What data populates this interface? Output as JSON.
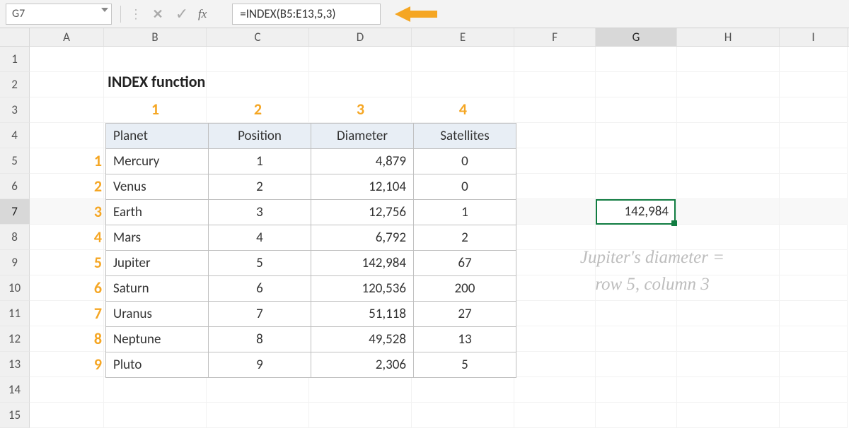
{
  "name_box": "G7",
  "formula": "=INDEX(B5:E13,5,3)",
  "fx_label": "fx",
  "columns": [
    "A",
    "B",
    "C",
    "D",
    "E",
    "F",
    "G",
    "H",
    "I"
  ],
  "rows": [
    "1",
    "2",
    "3",
    "4",
    "5",
    "6",
    "7",
    "8",
    "9",
    "10",
    "11",
    "12",
    "13",
    "14",
    "15"
  ],
  "title": "INDEX function",
  "col_numbers": [
    "1",
    "2",
    "3",
    "4"
  ],
  "row_numbers": [
    "1",
    "2",
    "3",
    "4",
    "5",
    "6",
    "7",
    "8",
    "9"
  ],
  "headers": {
    "planet": "Planet",
    "position": "Position",
    "diameter": "Diameter",
    "satellites": "Satellites"
  },
  "planets": [
    {
      "name": "Mercury",
      "position": "1",
      "diameter": "4,879",
      "satellites": "0"
    },
    {
      "name": "Venus",
      "position": "2",
      "diameter": "12,104",
      "satellites": "0"
    },
    {
      "name": "Earth",
      "position": "3",
      "diameter": "12,756",
      "satellites": "1"
    },
    {
      "name": "Mars",
      "position": "4",
      "diameter": "6,792",
      "satellites": "2"
    },
    {
      "name": "Jupiter",
      "position": "5",
      "diameter": "142,984",
      "satellites": "67"
    },
    {
      "name": "Saturn",
      "position": "6",
      "diameter": "120,536",
      "satellites": "200"
    },
    {
      "name": "Uranus",
      "position": "7",
      "diameter": "51,118",
      "satellites": "27"
    },
    {
      "name": "Neptune",
      "position": "8",
      "diameter": "49,528",
      "satellites": "13"
    },
    {
      "name": "Pluto",
      "position": "9",
      "diameter": "2,306",
      "satellites": "5"
    }
  ],
  "selected_value": "142,984",
  "annotation_line1": "Jupiter's diameter =",
  "annotation_line2": "row 5, column 3",
  "colors": {
    "accent": "#f5a623",
    "selection": "#107c41"
  }
}
